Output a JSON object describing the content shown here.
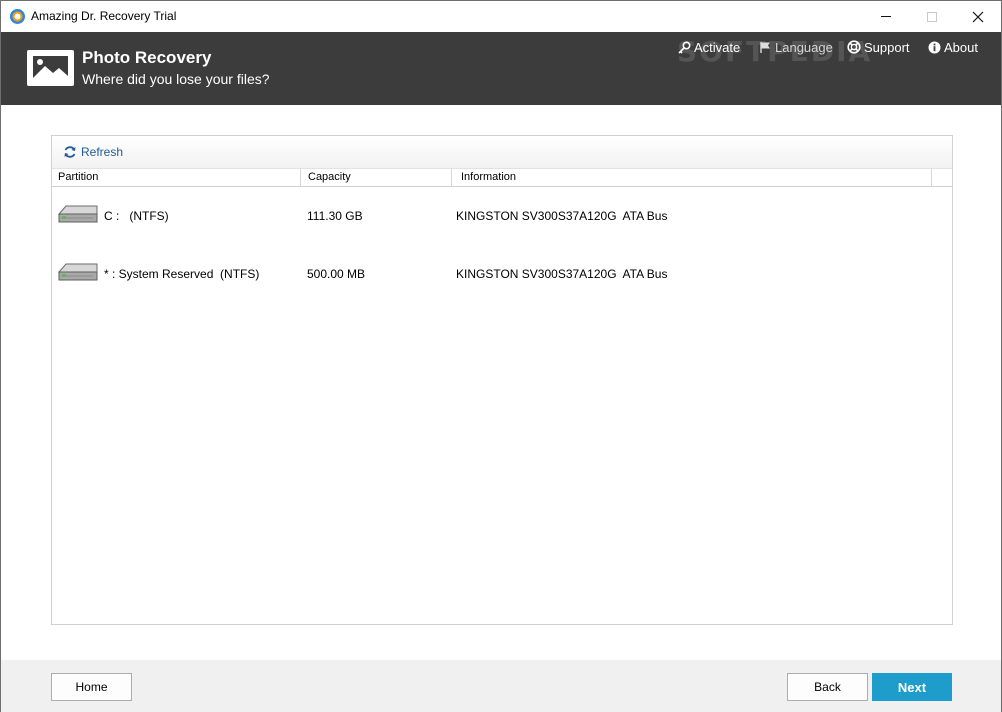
{
  "window": {
    "title": "Amazing Dr. Recovery Trial"
  },
  "header": {
    "title": "Photo Recovery",
    "subtitle": "Where did you lose your files?",
    "nav": {
      "activate": "Activate",
      "language": "Language",
      "support": "Support",
      "about": "About"
    },
    "watermark": "SOFTPEDIA"
  },
  "toolbar": {
    "refresh_label": "Refresh"
  },
  "table": {
    "columns": [
      "Partition",
      "Capacity",
      "Information"
    ],
    "rows": [
      {
        "partition": "C :   (NTFS)",
        "capacity": "111.30 GB",
        "information": "KINGSTON SV300S37A120G  ATA Bus"
      },
      {
        "partition": "* : System Reserved  (NTFS)",
        "capacity": "500.00 MB",
        "information": "KINGSTON SV300S37A120G  ATA Bus"
      }
    ]
  },
  "footer": {
    "home_label": "Home",
    "back_label": "Back",
    "next_label": "Next"
  },
  "colors": {
    "header_bg": "#3c3c3c",
    "accent": "#1e9ccb",
    "link": "#1f5a96"
  },
  "icons": {
    "app": "app-logo-icon",
    "header": "photo-image-icon",
    "activate": "key-icon",
    "language": "flag-icon",
    "support": "lifebuoy-icon",
    "about": "info-icon",
    "refresh": "refresh-icon",
    "drive": "hard-drive-icon"
  }
}
